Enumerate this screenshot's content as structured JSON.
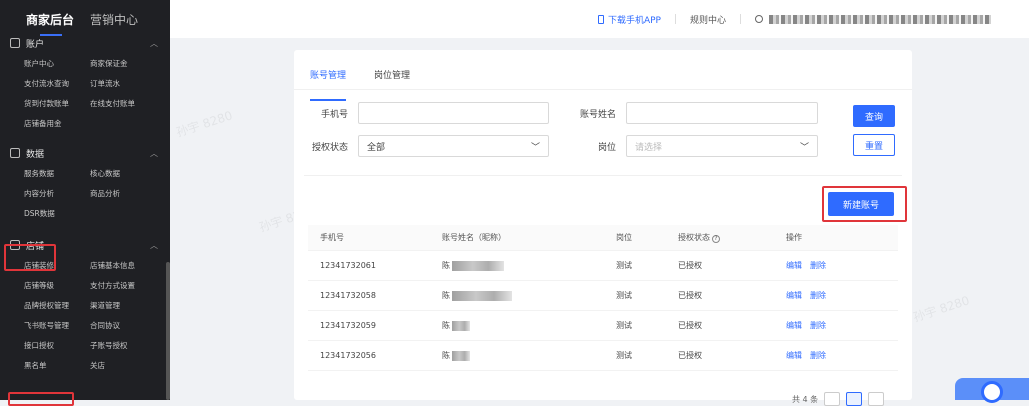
{
  "sidebar": {
    "brand": "商家后台",
    "brand_secondary": "营销中心",
    "groups": [
      {
        "title": "账户",
        "icon": "wallet-icon",
        "items": [
          "账户中心",
          "商家保证金",
          "支付流水查询",
          "订单流水",
          "货到付款账单",
          "在线支付账单",
          "店铺备用金"
        ]
      },
      {
        "title": "数据",
        "icon": "bar-chart-icon",
        "items": [
          "服务数据",
          "核心数据",
          "内容分析",
          "商品分析",
          "DSR数据"
        ]
      },
      {
        "title": "店铺",
        "icon": "shop-icon",
        "items": [
          "店铺装修",
          "店铺基本信息",
          "店铺等级",
          "支付方式设置",
          "品牌授权管理",
          "渠道管理",
          "飞书账号管理",
          "合同协议",
          "接口授权",
          "子账号授权",
          "黑名单",
          "关店"
        ]
      }
    ]
  },
  "topbar": {
    "download_app": "下载手机APP",
    "rules_center": "规则中心"
  },
  "tabs": [
    "账号管理",
    "岗位管理"
  ],
  "filters": {
    "phone_label": "手机号",
    "name_label": "账号姓名",
    "auth_label": "授权状态",
    "auth_value": "全部",
    "position_label": "岗位",
    "position_placeholder": "请选择",
    "query_button": "查询",
    "reset_button": "重置"
  },
  "new_account_button": "新建账号",
  "table": {
    "headers": [
      "手机号",
      "账号姓名（昵称）",
      "岗位",
      "授权状态",
      "操作"
    ],
    "rows": [
      {
        "phone": "12341732061",
        "name": "陈",
        "position": "测试",
        "status": "已授权"
      },
      {
        "phone": "12341732058",
        "name": "陈",
        "position": "测试",
        "status": "已授权"
      },
      {
        "phone": "12341732059",
        "name": "陈",
        "position": "测试",
        "status": "已授权"
      },
      {
        "phone": "12341732056",
        "name": "陈",
        "position": "测试",
        "status": "已授权"
      }
    ],
    "edit_label": "编辑",
    "delete_label": "删除"
  },
  "pagination": {
    "total": "共 4 条"
  },
  "watermark": "孙宇 8280",
  "colors": {
    "accent": "#2f6bff",
    "highlight": "#e0353a",
    "sidebar": "#1f2024"
  }
}
